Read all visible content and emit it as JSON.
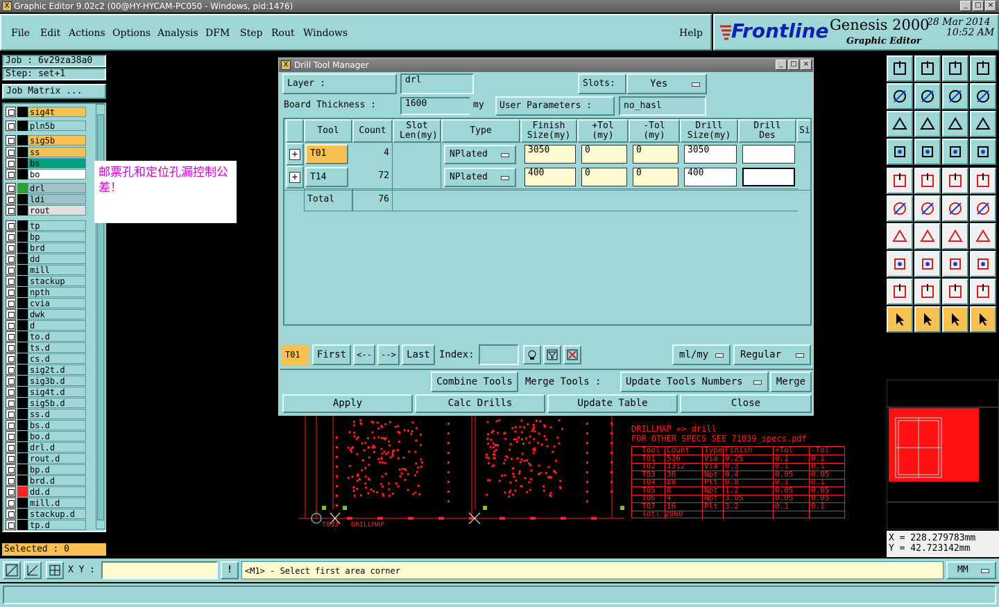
{
  "window": {
    "title": "Graphic Editor 9.02c2 (00@HY-HYCAM-PC050 - Windows, pid:1476)"
  },
  "menu": [
    "File",
    "Edit",
    "Actions",
    "Options",
    "Analysis",
    "DFM",
    "Step",
    "Rout",
    "Windows"
  ],
  "help": "Help",
  "logo": {
    "brand": "Frontline",
    "product": "Genesis 2000",
    "subtitle": "Graphic Editor",
    "date": "28 Mar 2014",
    "time": "10:52 AM"
  },
  "job": {
    "job_label": "Job : 6v29za38a0",
    "step_label": "Step: set+1",
    "matrix_button": "Job Matrix ..."
  },
  "layers": [
    {
      "name": "sig4t",
      "color": "#f7c050",
      "swatch": "#000"
    },
    {
      "name": "pln5b",
      "color": "#9ed7d5",
      "swatch": "#000"
    },
    {
      "name": "sig5b",
      "color": "#f7c050",
      "swatch": "#000"
    },
    {
      "name": "ss",
      "color": "#f7c050",
      "swatch": "#000"
    },
    {
      "name": "bs",
      "color": "#00a080",
      "swatch": "#000"
    },
    {
      "name": "bo",
      "color": "#ffffff",
      "swatch": "#000"
    },
    {
      "name": "drl",
      "color": "#9ec0c8",
      "swatch": "#30a030"
    },
    {
      "name": "ldi",
      "color": "#9ec0c8",
      "swatch": "#000"
    },
    {
      "name": "rout",
      "color": "#e0e0e0",
      "swatch": "#000"
    },
    {
      "name": "tp",
      "color": "#9ed7d5",
      "swatch": "#000"
    },
    {
      "name": "bp",
      "color": "#9ed7d5",
      "swatch": "#000"
    },
    {
      "name": "brd",
      "color": "#9ed7d5",
      "swatch": "#000"
    },
    {
      "name": "dd",
      "color": "#9ed7d5",
      "swatch": "#000"
    },
    {
      "name": "mill",
      "color": "#9ed7d5",
      "swatch": "#000"
    },
    {
      "name": "stackup",
      "color": "#9ed7d5",
      "swatch": "#000"
    },
    {
      "name": "npth",
      "color": "#9ed7d5",
      "swatch": "#000"
    },
    {
      "name": "cvia",
      "color": "#9ed7d5",
      "swatch": "#000"
    },
    {
      "name": "dwk",
      "color": "#9ed7d5",
      "swatch": "#000"
    },
    {
      "name": "d",
      "color": "#9ed7d5",
      "swatch": "#000"
    },
    {
      "name": "to.d",
      "color": "#9ed7d5",
      "swatch": "#000"
    },
    {
      "name": "ts.d",
      "color": "#9ed7d5",
      "swatch": "#000"
    },
    {
      "name": "cs.d",
      "color": "#9ed7d5",
      "swatch": "#000"
    },
    {
      "name": "sig2t.d",
      "color": "#9ed7d5",
      "swatch": "#000"
    },
    {
      "name": "sig3b.d",
      "color": "#9ed7d5",
      "swatch": "#000"
    },
    {
      "name": "sig4t.d",
      "color": "#9ed7d5",
      "swatch": "#000"
    },
    {
      "name": "sig5b.d",
      "color": "#9ed7d5",
      "swatch": "#000"
    },
    {
      "name": "ss.d",
      "color": "#9ed7d5",
      "swatch": "#000"
    },
    {
      "name": "bs.d",
      "color": "#9ed7d5",
      "swatch": "#000"
    },
    {
      "name": "bo.d",
      "color": "#9ed7d5",
      "swatch": "#000"
    },
    {
      "name": "drl.d",
      "color": "#9ed7d5",
      "swatch": "#000"
    },
    {
      "name": "rout.d",
      "color": "#9ed7d5",
      "swatch": "#000"
    },
    {
      "name": "bp.d",
      "color": "#9ed7d5",
      "swatch": "#000"
    },
    {
      "name": "brd.d",
      "color": "#9ed7d5",
      "swatch": "#000"
    },
    {
      "name": "dd.d",
      "color": "#9ed7d5",
      "swatch": "#ff2020"
    },
    {
      "name": "mill.d",
      "color": "#9ed7d5",
      "swatch": "#000"
    },
    {
      "name": "stackup.d",
      "color": "#9ed7d5",
      "swatch": "#000"
    },
    {
      "name": "tp.d",
      "color": "#9ed7d5",
      "swatch": "#000"
    }
  ],
  "selected": "Selected : 0",
  "popup_note": "邮票孔和定位孔漏控制公差！",
  "dialog": {
    "title": "Drill Tool Manager",
    "layer_label": "Layer          :",
    "layer_value": "drl",
    "slots_label": "Slots:",
    "slots_value": "Yes",
    "thickness_label": "Board Thickness :",
    "thickness_value": "1600",
    "thickness_unit": "my",
    "user_params_button": "User Parameters :",
    "user_params_value": "no_hasl",
    "columns": [
      "Tool",
      "Count",
      "Slot Len(my)",
      "Type",
      "Finish Size(my)",
      "+Tol (my)",
      "-Tol (my)",
      "Drill Size(my)",
      "Drill Des",
      "Si"
    ],
    "rows": [
      {
        "tool": "T01",
        "count": "4",
        "type": "NPlated",
        "finish": "3050",
        "ptol": "0",
        "ntol": "0",
        "drill": "3050",
        "des": ""
      },
      {
        "tool": "T14",
        "count": "72",
        "type": "NPlated",
        "finish": "400",
        "ptol": "0",
        "ntol": "0",
        "drill": "400",
        "des": ""
      }
    ],
    "total_label": "Total",
    "total_count": "76",
    "current_tool": "T01",
    "nav": [
      "First",
      "<--",
      "-->",
      "Last"
    ],
    "index_label": "Index:",
    "index_value": "",
    "units_option": "ml/my",
    "mode_option": "Regular",
    "combine": "Combine Tools",
    "merge_label": "Merge Tools :",
    "merge_option": "Update Tools Numbers",
    "merge_button": "Merge",
    "apply": "Apply",
    "calc": "Calc Drills",
    "update": "Update Table",
    "close": "Close"
  },
  "canvas": {
    "drillmap_title": "DRILLMAP => drill",
    "drillmap_note": "FOR OTHER SPECS SEE 71839_specs.pdf",
    "table_headers": [
      "Tool",
      "Count",
      "Type",
      "Finish",
      "+Tol",
      "-Tol"
    ],
    "table_rows": [
      [
        "T01",
        "536",
        "Via",
        "0.25",
        "0.1",
        "0.1"
      ],
      [
        "T02",
        "1312",
        "Via",
        "0.3",
        "0.1",
        "0.1"
      ],
      [
        "T03",
        "36",
        "Npt",
        "0.4",
        "0.05",
        "0.05"
      ],
      [
        "T04",
        "88",
        "Plt",
        "0.8",
        "0.1",
        "0.1"
      ],
      [
        "T05",
        "8",
        "Npt",
        "1.2",
        "0.05",
        "0.05"
      ],
      [
        "T06",
        "4",
        "Npt",
        "3.05",
        "0.05",
        "0.05"
      ],
      [
        "T07",
        "16",
        "Plt",
        "3.2",
        "0.1",
        "0.1"
      ]
    ],
    "table_total": "Totl 2060",
    "drillmap_label": "DRILLMAP",
    "drill_tag": "T033"
  },
  "coords": {
    "x": "X =  228.279783mm",
    "y": "Y =   42.723142mm"
  },
  "status": {
    "xy_label": "X Y :",
    "xy_value": "",
    "prompt": "<M1> - Select first area corner",
    "units": "MM"
  },
  "colors": {
    "panel": "#9ed7d5",
    "highlight": "#f7c050",
    "drawing": "#ff2020"
  }
}
